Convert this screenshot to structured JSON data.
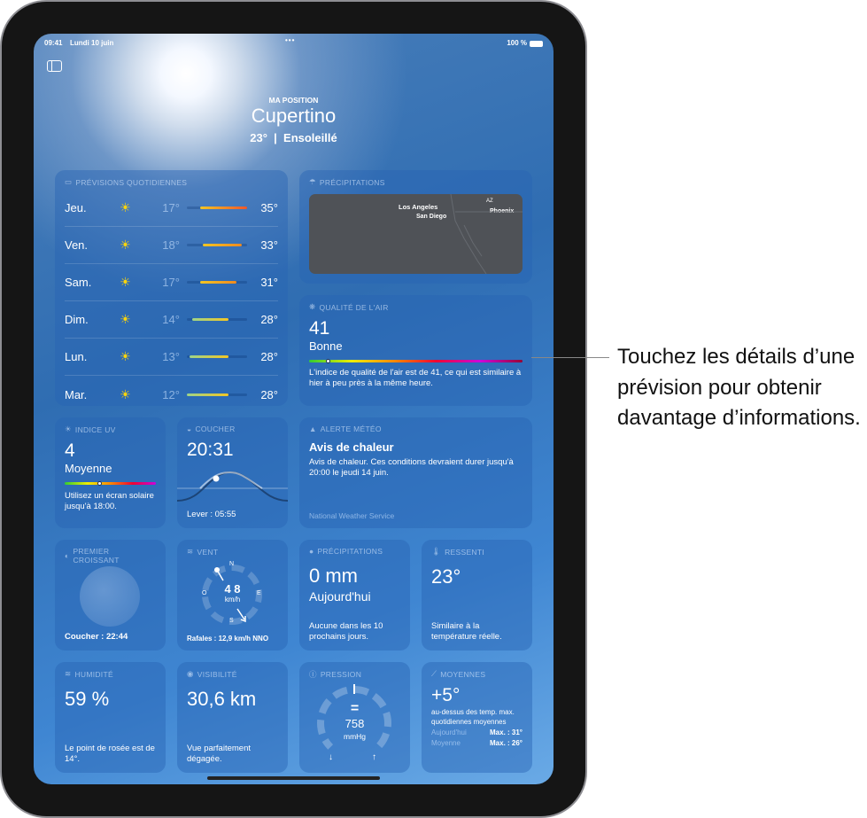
{
  "status": {
    "time": "09:41",
    "date": "Lundi 10 juin",
    "battery": "100 %"
  },
  "header": {
    "location_label": "MA POSITION",
    "city": "Cupertino",
    "current": "23°  |  Ensoleillé"
  },
  "forecast": {
    "title": "PRÉVISIONS QUOTIDIENNES",
    "range": [
      12,
      35
    ],
    "days": [
      {
        "day": "Jeu.",
        "icon": "sun-icon",
        "lo": 17,
        "hi": 35,
        "lo_label": "17°",
        "hi_label": "35°"
      },
      {
        "day": "Ven.",
        "icon": "sun-icon",
        "lo": 18,
        "hi": 33,
        "lo_label": "18°",
        "hi_label": "33°"
      },
      {
        "day": "Sam.",
        "icon": "sun-icon",
        "lo": 17,
        "hi": 31,
        "lo_label": "17°",
        "hi_label": "31°"
      },
      {
        "day": "Dim.",
        "icon": "sun-icon",
        "lo": 14,
        "hi": 28,
        "lo_label": "14°",
        "hi_label": "28°"
      },
      {
        "day": "Lun.",
        "icon": "sun-icon",
        "lo": 13,
        "hi": 28,
        "lo_label": "13°",
        "hi_label": "28°"
      },
      {
        "day": "Mar.",
        "icon": "sun-icon",
        "lo": 12,
        "hi": 28,
        "lo_label": "12°",
        "hi_label": "28°"
      }
    ]
  },
  "precip_map": {
    "title": "PRÉCIPITATIONS",
    "labels": [
      "Los Angeles",
      "San Diego",
      "AZ",
      "Phoenix"
    ]
  },
  "air": {
    "title": "QUALITÉ DE L'AIR",
    "value": "41",
    "level": "Bonne",
    "index_fraction": 0.08,
    "desc": "L'indice de qualité de l'air est de 41, ce qui est similaire à hier à peu près à la même heure."
  },
  "uv": {
    "title": "INDICE UV",
    "value": "4",
    "level": "Moyenne",
    "fraction": 0.36,
    "desc": "Utilisez un écran solaire jusqu'à 18:00."
  },
  "sunset": {
    "title": "COUCHER",
    "value": "20:31",
    "sunrise": "Lever : 05:55"
  },
  "alert": {
    "title": "ALERTE MÉTÉO",
    "heading": "Avis de chaleur",
    "desc": "Avis de chaleur. Ces conditions devraient durer jusqu'à 20:00 le jeudi 14 juin.",
    "source": "National Weather Service"
  },
  "moon": {
    "title": "PREMIER CROISSANT",
    "set": "Coucher : 22:44"
  },
  "wind": {
    "title": "VENT",
    "speed": "4 8",
    "unit": "km/h",
    "gusts": "Rafales : 12,9 km/h NNO",
    "n": "N",
    "s": "S",
    "e": "E",
    "w": "O"
  },
  "precip": {
    "title": "PRÉCIPITATIONS",
    "value": "0 mm",
    "period": "Aujourd'hui",
    "desc": "Aucune dans les 10 prochains jours."
  },
  "feels": {
    "title": "RESSENTI",
    "value": "23°",
    "desc": "Similaire à la température réelle."
  },
  "humidity": {
    "title": "HUMIDITÉ",
    "value": "59 %",
    "desc": "Le point de rosée est de 14°."
  },
  "visibility": {
    "title": "VISIBILITÉ",
    "value": "30,6 km",
    "desc": "Vue parfaitement dégagée."
  },
  "pressure": {
    "title": "PRESSION",
    "trend": "=",
    "value": "758",
    "unit": "mmHg"
  },
  "averages": {
    "title": "MOYENNES",
    "value": "+5°",
    "desc": "au-dessus des temp. max. quotidiennes moyennes",
    "today_label": "Aujourd'hui",
    "today_value": "Max. : 31°",
    "avg_label": "Moyenne",
    "avg_value": "Max. : 26°"
  },
  "callout": "Touchez les détails d’une prévision pour obtenir davantage d’informations."
}
